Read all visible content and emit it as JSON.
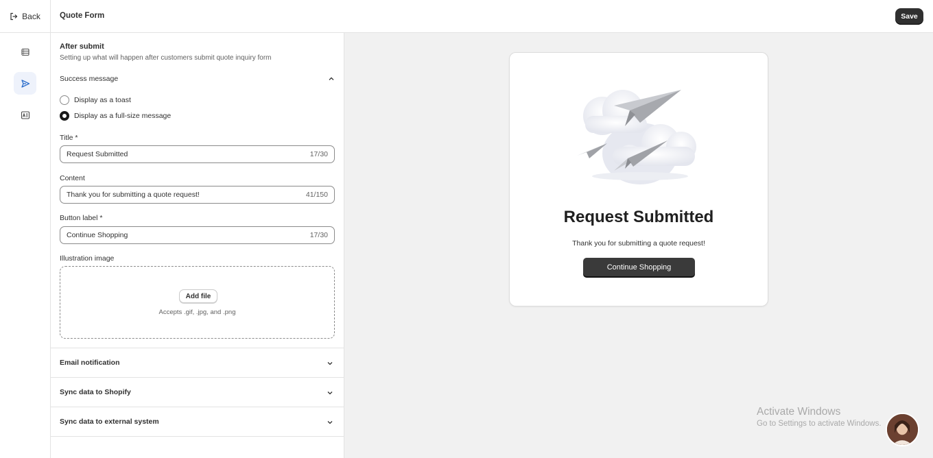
{
  "header": {
    "back_label": "Back",
    "title": "Quote Form",
    "save_label": "Save"
  },
  "rail": {
    "items": [
      {
        "icon": "form-fields-icon",
        "active": false
      },
      {
        "icon": "send-icon",
        "active": true
      },
      {
        "icon": "image-text-icon",
        "active": false
      }
    ]
  },
  "after_submit": {
    "title": "After submit",
    "subtitle": "Setting up what will happen after customers submit quote inquiry form",
    "success_message": {
      "header": "Success message",
      "expanded": true,
      "options": [
        {
          "label": "Display as a toast",
          "checked": false
        },
        {
          "label": "Display as a full-size message",
          "checked": true
        }
      ],
      "title_label": "Title *",
      "title_value": "Request Submitted",
      "title_count": "17/30",
      "content_label": "Content",
      "content_value": "Thank you for submitting a quote request!",
      "content_count": "41/150",
      "button_label_label": "Button label *",
      "button_label_value": "Continue Shopping",
      "button_label_count": "17/30",
      "illustration_label": "Illustration image",
      "add_file_label": "Add file",
      "accepts_text": "Accepts .gif, .jpg, and .png"
    },
    "sections": [
      {
        "label": "Email notification"
      },
      {
        "label": "Sync data to Shopify"
      },
      {
        "label": "Sync data to external system"
      }
    ]
  },
  "preview": {
    "title": "Request Submitted",
    "content": "Thank you for submitting a quote request!",
    "button_label": "Continue Shopping"
  },
  "watermark": {
    "title": "Activate Windows",
    "subtitle": "Go to Settings to activate Windows."
  },
  "colors": {
    "primary_button": "#303030",
    "preview_background": "#f1f1f1",
    "active_rail": "#eef2fb",
    "accent_icon": "#2c6ecb"
  }
}
